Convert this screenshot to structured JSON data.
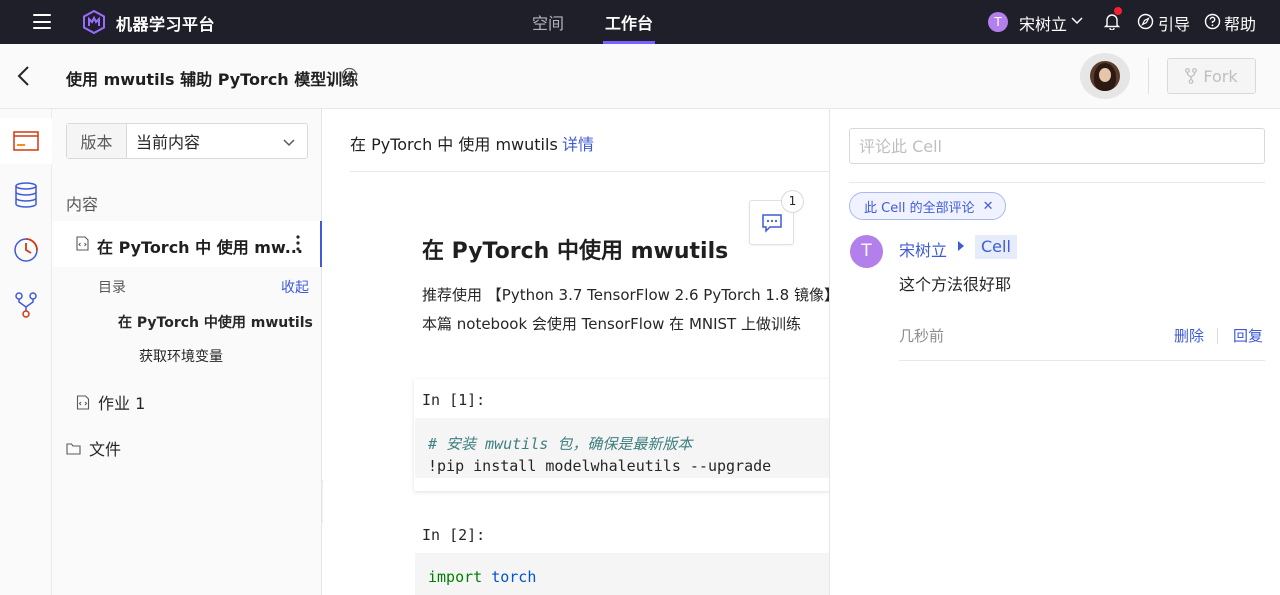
{
  "topnav": {
    "brand": "机器学习平台",
    "tabs": [
      {
        "label": "空间",
        "active": false
      },
      {
        "label": "工作台",
        "active": true
      }
    ],
    "user": {
      "initial": "T",
      "name": "宋树立"
    },
    "guide": "引导",
    "help": "帮助",
    "accent": "#7b61ff"
  },
  "header": {
    "title": "使用 mwutils 辅助 PyTorch 模型训练",
    "fork_label": "Fork"
  },
  "leftpanel": {
    "version_label": "版本",
    "version_value": "当前内容",
    "content_label": "内容",
    "notebook_title": "在 PyTorch 中 使用 mw...",
    "toc_label": "目录",
    "toc_collapse": "收起",
    "toc_items": [
      "在 PyTorch 中使用 mwutils",
      "获取环境变量"
    ],
    "homework": "作业 1",
    "files": "文件"
  },
  "center": {
    "crumb_title": "在 PyTorch 中 使用 mwutils",
    "crumb_link": "详情",
    "comment_count": "1",
    "md_heading": "在 PyTorch 中使用 mwutils",
    "md_line1": "推荐使用 【Python 3.7 TensorFlow 2.6 PyTorch 1.8 镜像】",
    "md_line2": "本篇 notebook 会使用 TensorFlow 在 MNIST 上做训练",
    "cells": [
      {
        "prompt": "In [1]:",
        "comment": "# 安装 mwutils 包，确保是最新版本",
        "code": "!pip install modelwhaleutils --upgrade"
      },
      {
        "prompt": "In [2]:",
        "kw": "import",
        "name": "torch"
      }
    ]
  },
  "comments": {
    "input_placeholder": "评论此 Cell",
    "filter_tag": "此 Cell 的全部评论",
    "items": [
      {
        "initial": "T",
        "author": "宋树立",
        "target": "Cell",
        "text": "这个方法很好耶",
        "time": "几秒前",
        "delete": "删除",
        "reply": "回复"
      }
    ]
  },
  "icons": [
    "menu-icon",
    "logo-icon",
    "chevron-down-icon",
    "bell-icon",
    "compass-icon",
    "help-icon",
    "back-icon",
    "info-icon",
    "fork-icon",
    "folder-icon",
    "database-icon",
    "clock-icon",
    "branch-icon",
    "notebook-icon",
    "more-icon",
    "file-icon",
    "comment-icon",
    "caret-right-icon",
    "collapse-left-icon",
    "collapse-right-icon"
  ]
}
